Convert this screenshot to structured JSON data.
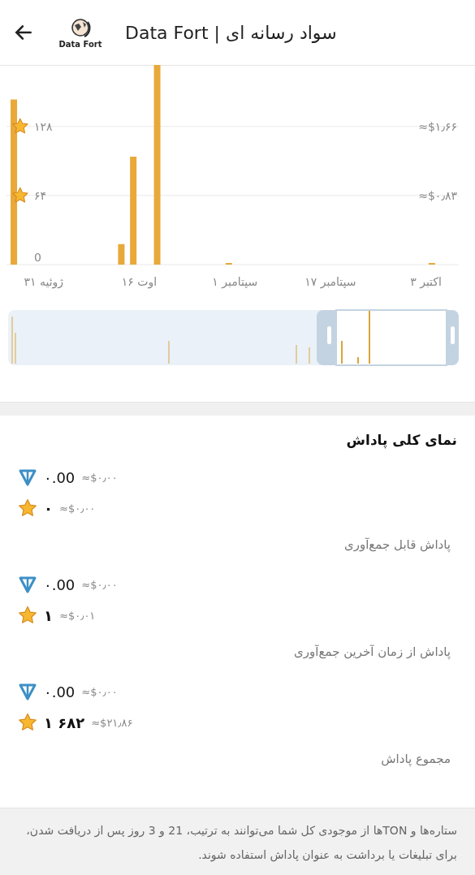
{
  "header": {
    "title": "سواد رسانه ای | Data Fort",
    "logo_text": "Data Fort"
  },
  "chart": {
    "chart_data": {
      "type": "bar",
      "ylim": [
        0,
        185
      ],
      "categories": [
        null,
        null,
        null,
        null,
        null,
        null,
        "ژوئیه ۳۱",
        null,
        null,
        null,
        null,
        null,
        null,
        null,
        null,
        null,
        null,
        null,
        null,
        null,
        null,
        null,
        "اوت ۱۶",
        null,
        null,
        null,
        null,
        null,
        null,
        null,
        null,
        null,
        null,
        null,
        null,
        null,
        null,
        null,
        "سپتامبر ۱",
        null,
        null,
        null,
        null,
        null,
        null,
        null,
        null,
        null,
        null,
        null,
        null,
        null,
        null,
        null,
        "سپتامبر ۱۷",
        null,
        null,
        null,
        null,
        null,
        null,
        null,
        null,
        null,
        null,
        null,
        null,
        null,
        null,
        null,
        "اکتبر ۳",
        null,
        null,
        null,
        null,
        null
      ],
      "series": [
        {
          "color": "#e8a93a",
          "values": [
            null,
            153,
            null,
            null,
            null,
            null,
            null,
            null,
            null,
            null,
            null,
            null,
            null,
            null,
            null,
            null,
            null,
            null,
            null,
            19,
            null,
            100,
            null,
            null,
            null,
            185,
            null,
            null,
            null,
            null,
            null,
            null,
            null,
            null,
            null,
            null,
            null,
            1,
            null,
            null,
            null,
            null,
            null,
            null,
            null,
            null,
            null,
            null,
            null,
            null,
            null,
            null,
            null,
            null,
            null,
            null,
            null,
            null,
            null,
            null,
            null,
            null,
            null,
            null,
            null,
            null,
            null,
            null,
            null,
            null,
            null,
            1,
            null,
            null,
            null,
            null
          ]
        }
      ],
      "yticks": [
        {
          "value": 0,
          "label": "0"
        },
        {
          "value": 64,
          "label": "۶۴"
        },
        {
          "value": 128,
          "label": "۱۲۸"
        }
      ]
    },
    "usd_labels": [
      "≈$۱٫۶۶",
      "≈$۰٫۸۳"
    ]
  },
  "rewards": {
    "title": "نمای کلی پاداش",
    "groups": [
      {
        "label": "پاداش قابل جمع‌آوری",
        "rows": [
          {
            "kind": "ton",
            "amount": "۰.00",
            "usd": "≈$۰٫۰۰"
          },
          {
            "kind": "star",
            "amount": "۰",
            "usd": "≈$۰٫۰۰"
          }
        ]
      },
      {
        "label": "پاداش از زمان آخرین جمع‌آوری",
        "rows": [
          {
            "kind": "ton",
            "amount": "۰.00",
            "usd": "≈$۰٫۰۰"
          },
          {
            "kind": "star",
            "amount": "۱",
            "usd": "≈$۰٫۰۱"
          }
        ]
      },
      {
        "label": "مجموع پاداش",
        "rows": [
          {
            "kind": "ton",
            "amount": "۰.00",
            "usd": "≈$۰٫۰۰"
          },
          {
            "kind": "star",
            "amount": "۱ ۶۸۲",
            "usd": "≈$۲۱٫۸۶"
          }
        ]
      }
    ]
  },
  "note": "ستاره‌ها و TONها از موجودی کل شما می‌توانند به ترتیب، 21 و 3 روز پس از دریافت شدن، برای تبلیغات یا برداشت به عنوان پاداش استفاده شوند."
}
